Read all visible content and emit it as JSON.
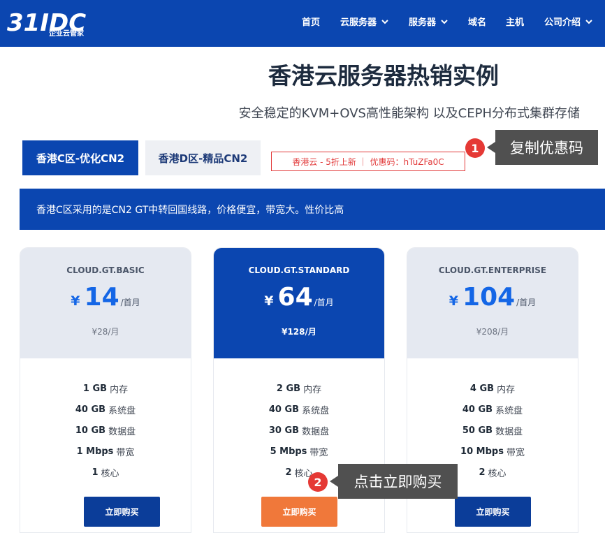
{
  "header": {
    "logo_text": "31IDC",
    "logo_sub": "企业云管家",
    "nav": [
      {
        "label": "首页",
        "has_menu": false
      },
      {
        "label": "云服务器",
        "has_menu": true
      },
      {
        "label": "服务器",
        "has_menu": true
      },
      {
        "label": "域名",
        "has_menu": false
      },
      {
        "label": "主机",
        "has_menu": false
      },
      {
        "label": "公司介绍",
        "has_menu": true
      }
    ]
  },
  "hero": {
    "title": "香港云服务器热销实例",
    "subtitle": "安全稳定的KVM+OVS高性能架构 以及CEPH分布式集群存储"
  },
  "tabs": [
    {
      "label": "香港C区-优化CN2",
      "active": true
    },
    {
      "label": "香港D区-精品CN2",
      "active": false
    }
  ],
  "promo": "香港云 - 5折上新 ｜ 优惠码：hTuZFa0C",
  "annotations": [
    {
      "number": "1",
      "text": "复制优惠码"
    },
    {
      "number": "2",
      "text": "点击立即购买"
    }
  ],
  "banner": "香港C区采用的是CN2 GT中转回国线路，价格便宜，带宽大。性价比高",
  "plans": [
    {
      "name": "CLOUD.GT.BASIC",
      "currency": "¥",
      "price": "14",
      "period": "/首月",
      "original": "¥28/月",
      "featured": false,
      "specs": [
        {
          "value": "1 GB",
          "unit": "内存"
        },
        {
          "value": "40 GB",
          "unit": "系统盘"
        },
        {
          "value": "10 GB",
          "unit": "数据盘"
        },
        {
          "value": "1 Mbps",
          "unit": "带宽"
        },
        {
          "value": "1",
          "unit": "核心"
        }
      ],
      "buy_label": "立即购买"
    },
    {
      "name": "CLOUD.GT.STANDARD",
      "currency": "¥",
      "price": "64",
      "period": "/首月",
      "original": "¥128/月",
      "featured": true,
      "specs": [
        {
          "value": "2 GB",
          "unit": "内存"
        },
        {
          "value": "40 GB",
          "unit": "系统盘"
        },
        {
          "value": "30 GB",
          "unit": "数据盘"
        },
        {
          "value": "5 Mbps",
          "unit": "带宽"
        },
        {
          "value": "2",
          "unit": "核心"
        }
      ],
      "buy_label": "立即购买"
    },
    {
      "name": "CLOUD.GT.ENTERPRISE",
      "currency": "¥",
      "price": "104",
      "period": "/首月",
      "original": "¥208/月",
      "featured": false,
      "specs": [
        {
          "value": "4 GB",
          "unit": "内存"
        },
        {
          "value": "40 GB",
          "unit": "系统盘"
        },
        {
          "value": "50 GB",
          "unit": "数据盘"
        },
        {
          "value": "10 Mbps",
          "unit": "带宽"
        },
        {
          "value": "2",
          "unit": "核心"
        }
      ],
      "buy_label": "立即购买"
    }
  ],
  "colors": {
    "brand_blue": "#0b46b0",
    "price_blue": "#1466e6",
    "buy_orange": "#f0783a",
    "promo_red": "#e23b3b",
    "callout_gray": "#505050"
  }
}
